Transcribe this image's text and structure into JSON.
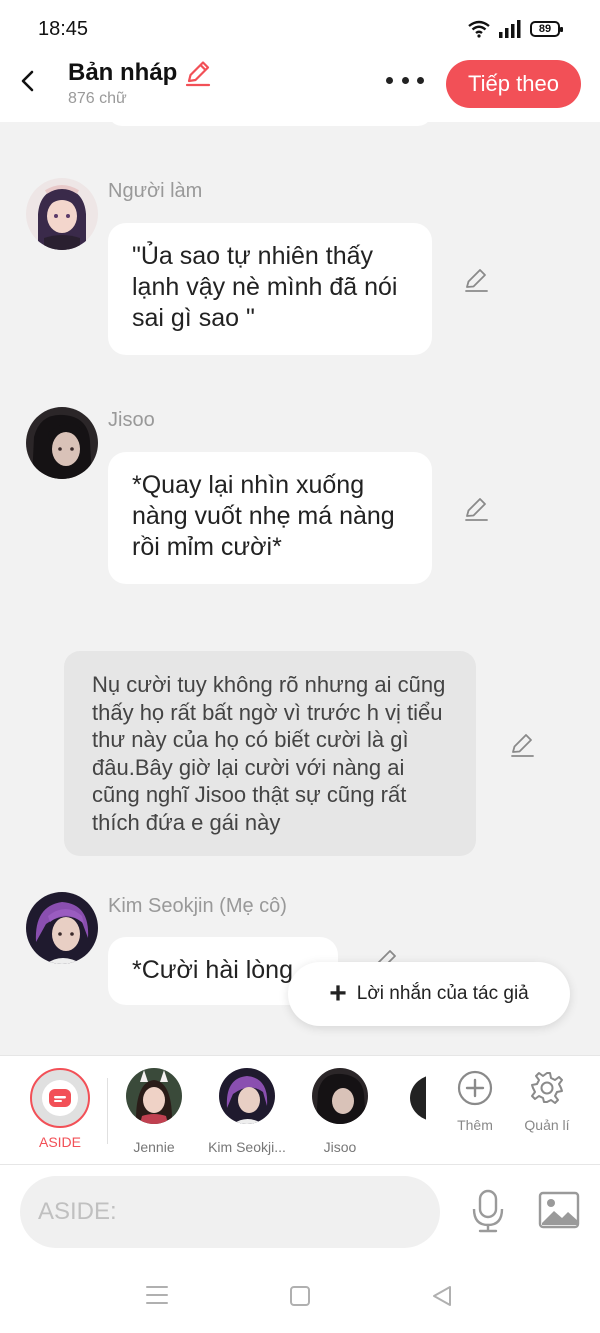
{
  "status_bar": {
    "time": "18:45",
    "battery": "89"
  },
  "header": {
    "title": "Bản nháp",
    "word_count": "876 chữ",
    "next_label": "Tiếp theo"
  },
  "messages": [
    {
      "name": "Người làm",
      "text": "\"Ủa sao tự nhiên thấy lạnh vậy  nè mình đã nói sai gì sao \""
    },
    {
      "name": "Jisoo",
      "text": "*Quay lại nhìn xuống nàng vuốt nhẹ má nàng rồi mỉm cười*"
    },
    {
      "name": "Kim Seokjin (Mẹ cô)",
      "text": "*Cười hài lòng"
    }
  ],
  "narration": "Nụ cười tuy không  rõ nhưng ai cũng thấy họ rất bất ngờ vì trước h vị tiểu thư này của họ có biết cười là gì đâu.Bây giờ lại cười với nàng ai cũng nghĩ Jisoo thật sự cũng rất thích  đứa e gái này",
  "fab_label": "Lời nhắn của tác giả",
  "character_bar": {
    "aside": "ASIDE",
    "characters": [
      "Jennie",
      "Kim Seokji...",
      "Jisoo"
    ],
    "add_label": "Thêm",
    "manage_label": "Quản lí"
  },
  "input": {
    "placeholder": "ASIDE:"
  },
  "colors": {
    "accent": "#f25057",
    "background": "#f2f2f2",
    "bubble": "#ffffff",
    "narration": "#e6e6e6"
  }
}
